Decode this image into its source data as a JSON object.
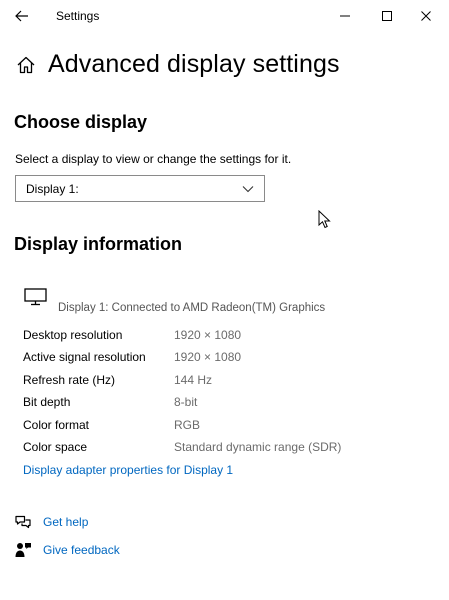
{
  "window": {
    "title": "Settings"
  },
  "page": {
    "title": "Advanced display settings"
  },
  "choose_display": {
    "heading": "Choose display",
    "instruction": "Select a display to view or change the settings for it.",
    "selected": "Display 1:"
  },
  "display_info": {
    "heading": "Display information",
    "connected_text": "Display 1: Connected to AMD Radeon(TM) Graphics",
    "rows": [
      {
        "label": "Desktop resolution",
        "value": "1920 × 1080"
      },
      {
        "label": "Active signal resolution",
        "value": "1920 × 1080"
      },
      {
        "label": "Refresh rate (Hz)",
        "value": "144 Hz"
      },
      {
        "label": "Bit depth",
        "value": "8-bit"
      },
      {
        "label": "Color format",
        "value": "RGB"
      },
      {
        "label": "Color space",
        "value": "Standard dynamic range (SDR)"
      }
    ],
    "adapter_link": "Display adapter properties for Display 1"
  },
  "support": {
    "get_help": "Get help",
    "give_feedback": "Give feedback"
  },
  "colors": {
    "link": "#0067c0",
    "value_text": "#6b6b6b"
  }
}
